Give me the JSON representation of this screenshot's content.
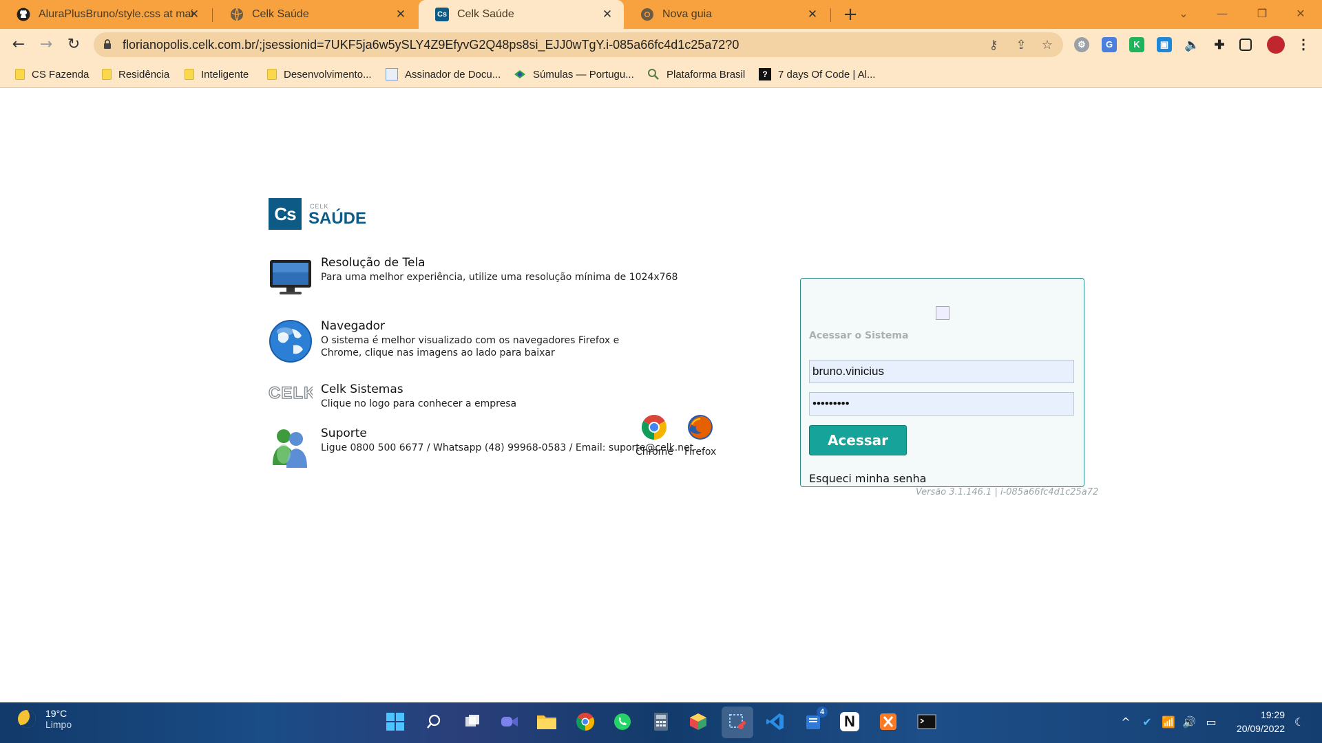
{
  "tabs": [
    {
      "title": "AluraPlusBruno/style.css at main",
      "icon": "github-icon",
      "active": false
    },
    {
      "title": "Celk Saúde",
      "icon": "globe-icon",
      "active": false
    },
    {
      "title": "Celk Saúde",
      "icon": "celk-icon",
      "active": true
    },
    {
      "title": "Nova guia",
      "icon": "chrome-icon",
      "active": false
    }
  ],
  "toolbar": {
    "url": "florianopolis.celk.com.br/;jsessionid=7UKF5ja6w5ySLY4Z9EfyvG2Q48ps8si_EJJ0wTgY.i-085a66fc4d1c25a72?0"
  },
  "bookmarks": [
    {
      "label": "CS Fazenda",
      "icon": "folder-icon"
    },
    {
      "label": "Residência",
      "icon": "folder-icon"
    },
    {
      "label": "Inteligente",
      "icon": "folder-icon"
    },
    {
      "label": "Desenvolvimento...",
      "icon": "folder-icon"
    },
    {
      "label": "Assinador de Docu...",
      "icon": "assinador-icon"
    },
    {
      "label": "Súmulas — Portugu...",
      "icon": "brazil-icon"
    },
    {
      "label": "Plataforma Brasil",
      "icon": "plataforma-icon"
    },
    {
      "label": "7 days Of Code | Al...",
      "icon": "question-icon"
    }
  ],
  "page": {
    "logo": {
      "small": "CELK",
      "big": "SAÚDE",
      "box": "Cs"
    },
    "sections": [
      {
        "title": "Resolução de Tela",
        "desc": "Para uma melhor experiência, utilize uma resolução mínima de 1024x768",
        "icon": "monitor-icon"
      },
      {
        "title": "Navegador",
        "desc": "O sistema é melhor visualizado com os navegadores Firefox e Chrome, clique nas imagens ao lado para baixar",
        "icon": "globe-icon"
      },
      {
        "title": "Celk Sistemas",
        "desc": "Clique no logo para conhecer a empresa",
        "icon": "celk-logo-icon"
      },
      {
        "title": "Suporte",
        "desc": "Ligue 0800 500 6677 / Whatsapp (48) 99968-0583 / Email: suporte@celk.net",
        "icon": "support-users-icon"
      }
    ],
    "celk_logo_text": "CELK",
    "browsers": [
      {
        "label": "Chrome",
        "icon": "chrome-icon"
      },
      {
        "label": "Firefox",
        "icon": "firefox-icon"
      }
    ]
  },
  "login": {
    "subtitle": "Acessar o Sistema",
    "username": "bruno.vinicius",
    "password": "•••••••••",
    "submit": "Acessar",
    "forgot": "Esqueci minha senha"
  },
  "version": "Versão 3.1.146.1 | i-085a66fc4d1c25a72",
  "taskbar": {
    "weather_temp": "19°C",
    "weather_desc": "Limpo",
    "time": "19:29",
    "date": "20/09/2022",
    "badge": "4"
  },
  "colors": {
    "tab_bar": "#f7a23f",
    "toolbar": "#fde7c7",
    "brand": "#0e5a86",
    "button": "#15a39a"
  }
}
